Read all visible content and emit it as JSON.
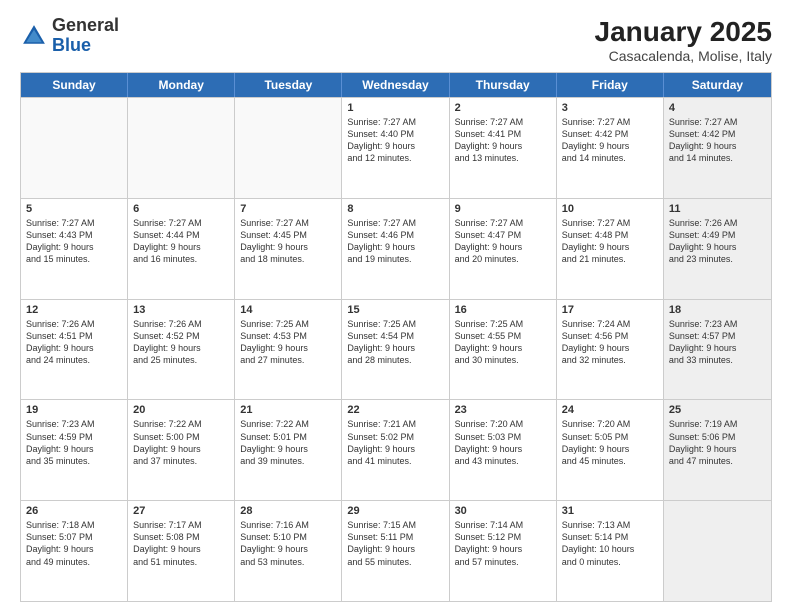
{
  "header": {
    "logo_general": "General",
    "logo_blue": "Blue",
    "month_title": "January 2025",
    "location": "Casacalenda, Molise, Italy"
  },
  "days_of_week": [
    "Sunday",
    "Monday",
    "Tuesday",
    "Wednesday",
    "Thursday",
    "Friday",
    "Saturday"
  ],
  "rows": [
    [
      {
        "day": "",
        "text": "",
        "empty": true
      },
      {
        "day": "",
        "text": "",
        "empty": true
      },
      {
        "day": "",
        "text": "",
        "empty": true
      },
      {
        "day": "1",
        "text": "Sunrise: 7:27 AM\nSunset: 4:40 PM\nDaylight: 9 hours\nand 12 minutes."
      },
      {
        "day": "2",
        "text": "Sunrise: 7:27 AM\nSunset: 4:41 PM\nDaylight: 9 hours\nand 13 minutes."
      },
      {
        "day": "3",
        "text": "Sunrise: 7:27 AM\nSunset: 4:42 PM\nDaylight: 9 hours\nand 14 minutes."
      },
      {
        "day": "4",
        "text": "Sunrise: 7:27 AM\nSunset: 4:42 PM\nDaylight: 9 hours\nand 14 minutes.",
        "shaded": true
      }
    ],
    [
      {
        "day": "5",
        "text": "Sunrise: 7:27 AM\nSunset: 4:43 PM\nDaylight: 9 hours\nand 15 minutes."
      },
      {
        "day": "6",
        "text": "Sunrise: 7:27 AM\nSunset: 4:44 PM\nDaylight: 9 hours\nand 16 minutes."
      },
      {
        "day": "7",
        "text": "Sunrise: 7:27 AM\nSunset: 4:45 PM\nDaylight: 9 hours\nand 18 minutes."
      },
      {
        "day": "8",
        "text": "Sunrise: 7:27 AM\nSunset: 4:46 PM\nDaylight: 9 hours\nand 19 minutes."
      },
      {
        "day": "9",
        "text": "Sunrise: 7:27 AM\nSunset: 4:47 PM\nDaylight: 9 hours\nand 20 minutes."
      },
      {
        "day": "10",
        "text": "Sunrise: 7:27 AM\nSunset: 4:48 PM\nDaylight: 9 hours\nand 21 minutes."
      },
      {
        "day": "11",
        "text": "Sunrise: 7:26 AM\nSunset: 4:49 PM\nDaylight: 9 hours\nand 23 minutes.",
        "shaded": true
      }
    ],
    [
      {
        "day": "12",
        "text": "Sunrise: 7:26 AM\nSunset: 4:51 PM\nDaylight: 9 hours\nand 24 minutes."
      },
      {
        "day": "13",
        "text": "Sunrise: 7:26 AM\nSunset: 4:52 PM\nDaylight: 9 hours\nand 25 minutes."
      },
      {
        "day": "14",
        "text": "Sunrise: 7:25 AM\nSunset: 4:53 PM\nDaylight: 9 hours\nand 27 minutes."
      },
      {
        "day": "15",
        "text": "Sunrise: 7:25 AM\nSunset: 4:54 PM\nDaylight: 9 hours\nand 28 minutes."
      },
      {
        "day": "16",
        "text": "Sunrise: 7:25 AM\nSunset: 4:55 PM\nDaylight: 9 hours\nand 30 minutes."
      },
      {
        "day": "17",
        "text": "Sunrise: 7:24 AM\nSunset: 4:56 PM\nDaylight: 9 hours\nand 32 minutes."
      },
      {
        "day": "18",
        "text": "Sunrise: 7:23 AM\nSunset: 4:57 PM\nDaylight: 9 hours\nand 33 minutes.",
        "shaded": true
      }
    ],
    [
      {
        "day": "19",
        "text": "Sunrise: 7:23 AM\nSunset: 4:59 PM\nDaylight: 9 hours\nand 35 minutes."
      },
      {
        "day": "20",
        "text": "Sunrise: 7:22 AM\nSunset: 5:00 PM\nDaylight: 9 hours\nand 37 minutes."
      },
      {
        "day": "21",
        "text": "Sunrise: 7:22 AM\nSunset: 5:01 PM\nDaylight: 9 hours\nand 39 minutes."
      },
      {
        "day": "22",
        "text": "Sunrise: 7:21 AM\nSunset: 5:02 PM\nDaylight: 9 hours\nand 41 minutes."
      },
      {
        "day": "23",
        "text": "Sunrise: 7:20 AM\nSunset: 5:03 PM\nDaylight: 9 hours\nand 43 minutes."
      },
      {
        "day": "24",
        "text": "Sunrise: 7:20 AM\nSunset: 5:05 PM\nDaylight: 9 hours\nand 45 minutes."
      },
      {
        "day": "25",
        "text": "Sunrise: 7:19 AM\nSunset: 5:06 PM\nDaylight: 9 hours\nand 47 minutes.",
        "shaded": true
      }
    ],
    [
      {
        "day": "26",
        "text": "Sunrise: 7:18 AM\nSunset: 5:07 PM\nDaylight: 9 hours\nand 49 minutes."
      },
      {
        "day": "27",
        "text": "Sunrise: 7:17 AM\nSunset: 5:08 PM\nDaylight: 9 hours\nand 51 minutes."
      },
      {
        "day": "28",
        "text": "Sunrise: 7:16 AM\nSunset: 5:10 PM\nDaylight: 9 hours\nand 53 minutes."
      },
      {
        "day": "29",
        "text": "Sunrise: 7:15 AM\nSunset: 5:11 PM\nDaylight: 9 hours\nand 55 minutes."
      },
      {
        "day": "30",
        "text": "Sunrise: 7:14 AM\nSunset: 5:12 PM\nDaylight: 9 hours\nand 57 minutes."
      },
      {
        "day": "31",
        "text": "Sunrise: 7:13 AM\nSunset: 5:14 PM\nDaylight: 10 hours\nand 0 minutes."
      },
      {
        "day": "",
        "text": "",
        "empty": true,
        "shaded": true
      }
    ]
  ]
}
